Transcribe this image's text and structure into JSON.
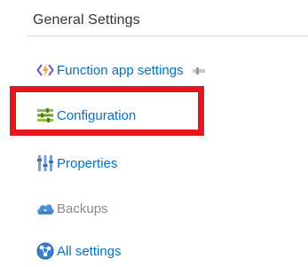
{
  "section": {
    "title": "General Settings"
  },
  "menu": {
    "items": [
      {
        "label": "Function app settings",
        "icon": "lightning-code-icon",
        "color": "#0072c6"
      },
      {
        "label": "Configuration",
        "icon": "sliders-icon",
        "color": "#0072c6"
      },
      {
        "label": "Properties",
        "icon": "properties-bars-icon",
        "color": "#0072c6"
      },
      {
        "label": "Backups",
        "icon": "cloud-backup-icon",
        "color": "#8a8a8a"
      },
      {
        "label": "All settings",
        "icon": "globe-network-icon",
        "color": "#0072c6"
      }
    ],
    "highlighted_item": "Configuration"
  },
  "colors": {
    "link": "#0072c6",
    "highlight_border": "#e3171c",
    "disabled_text": "#8a8a8a"
  }
}
